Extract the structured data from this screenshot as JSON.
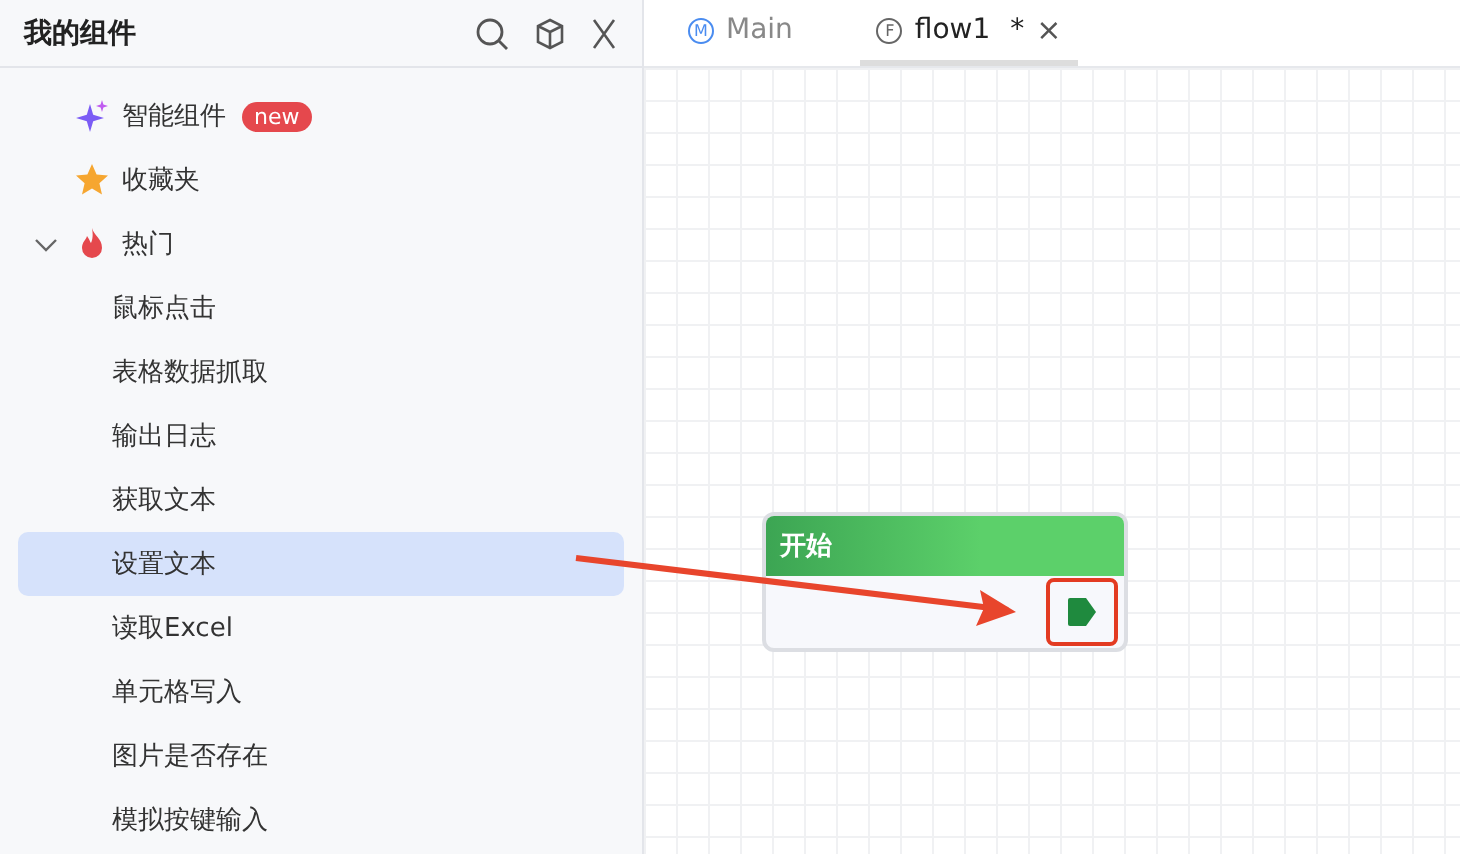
{
  "sidebar": {
    "title": "我的组件",
    "items": [
      {
        "kind": "sparkle",
        "label": "智能组件",
        "badge": "new",
        "selected": false
      },
      {
        "kind": "star",
        "label": "收藏夹",
        "selected": false
      },
      {
        "kind": "fire",
        "label": "热门",
        "expanded": true,
        "selected": false,
        "children": [
          {
            "label": "鼠标点击",
            "selected": false
          },
          {
            "label": "表格数据抓取",
            "selected": false
          },
          {
            "label": "输出日志",
            "selected": false
          },
          {
            "label": "获取文本",
            "selected": false
          },
          {
            "label": "设置文本",
            "selected": true
          },
          {
            "label": "读取Excel",
            "selected": false
          },
          {
            "label": "单元格写入",
            "selected": false
          },
          {
            "label": "图片是否存在",
            "selected": false
          },
          {
            "label": "模拟按键输入",
            "selected": false
          }
        ]
      }
    ]
  },
  "tabs": [
    {
      "letter": "M",
      "label": "Main",
      "selected": false
    },
    {
      "letter": "F",
      "label": "flow1",
      "modified": "*",
      "close": "×",
      "selected": true
    }
  ],
  "canvas": {
    "node": {
      "title": "开始",
      "port_highlighted": true
    },
    "arrow": true
  }
}
